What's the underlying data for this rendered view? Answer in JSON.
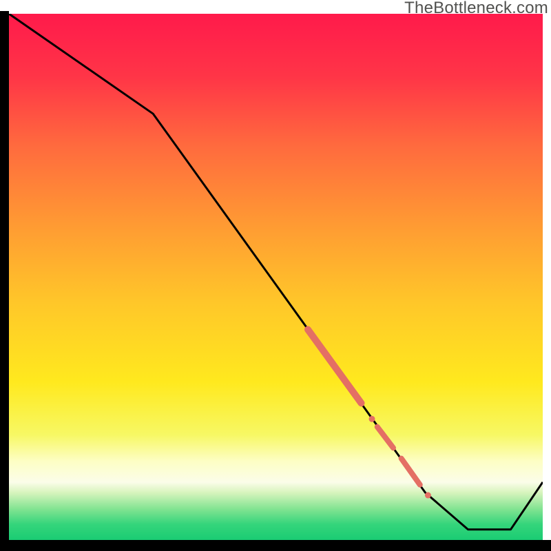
{
  "watermark": "TheBottleneck.com",
  "chart_data": {
    "type": "line",
    "title": "",
    "xlabel": "",
    "ylabel": "",
    "xlim": [
      0,
      100
    ],
    "ylim": [
      0,
      100
    ],
    "grid": false,
    "legend": false,
    "series": [
      {
        "name": "bottleneck-curve",
        "x": [
          0,
          27,
          78,
          86,
          94,
          100
        ],
        "y": [
          100,
          81,
          9,
          2,
          2,
          11
        ],
        "color": "#000000"
      }
    ],
    "highlights": [
      {
        "name": "segment-thick",
        "x": [
          56,
          66
        ],
        "y": [
          40,
          26
        ],
        "width": 10,
        "color": "#e46f64"
      },
      {
        "name": "segment-short1",
        "x": [
          69,
          72
        ],
        "y": [
          21.5,
          17.5
        ],
        "width": 8,
        "color": "#e46f64"
      },
      {
        "name": "dot-mid",
        "cx": 68,
        "cy": 23,
        "r": 4.5,
        "color": "#e46f64"
      },
      {
        "name": "segment-short2",
        "x": [
          73.5,
          77
        ],
        "y": [
          15.5,
          10.5
        ],
        "width": 8,
        "color": "#e46f64"
      },
      {
        "name": "dot-bottom",
        "cx": 78.5,
        "cy": 8.5,
        "r": 4.5,
        "color": "#e46f64"
      }
    ],
    "gradient_stops": [
      {
        "pct": 0,
        "color": "#ff1a4b"
      },
      {
        "pct": 12,
        "color": "#ff3547"
      },
      {
        "pct": 25,
        "color": "#ff6a3e"
      },
      {
        "pct": 40,
        "color": "#ff9a33"
      },
      {
        "pct": 55,
        "color": "#ffc729"
      },
      {
        "pct": 70,
        "color": "#ffe91e"
      },
      {
        "pct": 80,
        "color": "#f7f864"
      },
      {
        "pct": 85,
        "color": "#fdfec4"
      },
      {
        "pct": 89,
        "color": "#fbfde9"
      },
      {
        "pct": 91,
        "color": "#d7f4bd"
      },
      {
        "pct": 94,
        "color": "#85e493"
      },
      {
        "pct": 97,
        "color": "#35d57b"
      },
      {
        "pct": 100,
        "color": "#1acc73"
      }
    ]
  }
}
